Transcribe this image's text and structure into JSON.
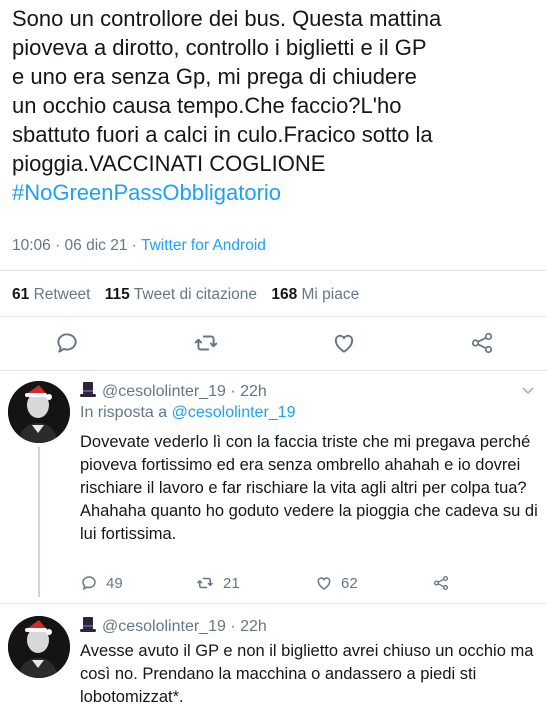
{
  "tweet": {
    "text": "Sono un controllore dei bus. Questa mattina pioveva a dirotto, controllo i biglietti e il GP e uno era senza Gp, mi prega di chiudere un occhio causa tempo.Che faccio?L'ho sbattuto fuori a calci in culo.Fracico sotto la pioggia.VACCINATI COGLIONE",
    "lines": [
      "Sono un controllore dei bus. Questa mattina",
      "pioveva a dirotto, controllo i biglietti e il GP",
      "e uno era senza Gp, mi prega di chiudere",
      "un occhio causa tempo.Che faccio?L'ho",
      "sbattuto fuori a calci in culo.Fracico sotto la",
      "pioggia.VACCINATI COGLIONE"
    ],
    "hashtag": "#NoGreenPassObbligatorio",
    "time": "10:06 · 06 dic 21 · ",
    "source": "Twitter for Android",
    "retweets": "61",
    "retweets_label": "Retweet",
    "quotes": "115",
    "quotes_label": "Tweet di citazione",
    "likes": "168",
    "likes_label": "Mi piace"
  },
  "actions": [
    "reply-icon",
    "retweet-icon",
    "like-icon",
    "share-icon"
  ],
  "colors": {
    "accent": "#1da1f2",
    "muted": "#657786",
    "text": "#14171a",
    "divider": "#e1e8ed"
  },
  "replies": [
    {
      "username": "@cesololinter_19",
      "time": "· 22h",
      "in_reply_prefix": "In risposta a ",
      "in_reply_handle": "@cesololinter_19",
      "body": "Dovevate vederlo lì con la faccia triste che mi pregava perché pioveva fortissimo ed era senza ombrello ahahah e io dovrei rischiare il lavoro e far rischiare la vita agli altri per colpa tua?\nAhahaha quanto ho goduto vedere la pioggia che cadeva su di lui fortissima.",
      "replies": "49",
      "retweets": "21",
      "likes": "62"
    },
    {
      "username": "@cesololinter_19",
      "time": "· 22h",
      "body": "Avesse avuto il GP e non il biglietto avrei chiuso un occhio ma così no. Prendano la macchina o andassero a piedi sti lobotomizzat*."
    }
  ]
}
